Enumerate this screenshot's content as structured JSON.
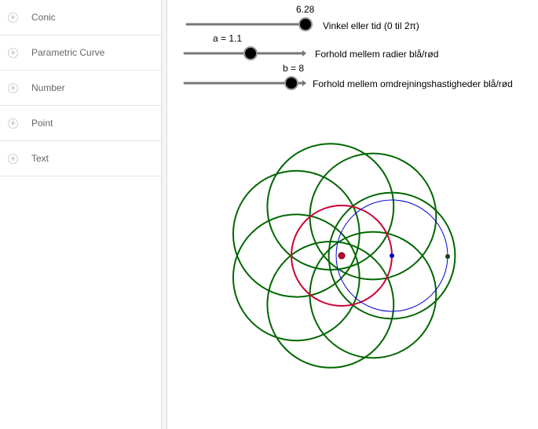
{
  "algebra": {
    "items": [
      {
        "label": "Conic"
      },
      {
        "label": "Parametric Curve"
      },
      {
        "label": "Number"
      },
      {
        "label": "Point"
      },
      {
        "label": "Text"
      }
    ],
    "expand_glyph": "+"
  },
  "sliders": {
    "angle": {
      "value_label": "6.28",
      "caption": "Vinkel eller tid (0 til 2π)",
      "value": 6.28,
      "min": 0,
      "max": 6.2832
    },
    "a": {
      "value_label": "a = 1.1",
      "caption": "Forhold mellem radier blå/rød",
      "value": 1.1
    },
    "b": {
      "value_label": "b = 8",
      "caption": "Forhold mellem omdrejningshastigheder blå/rød",
      "value": 8
    }
  },
  "colors": {
    "red_circle": "#cc0033",
    "blue_circle": "#0000cc",
    "green_circles": "#006600",
    "slider_track": "#666666",
    "slider_knob": "#000000"
  },
  "icons": {
    "expand": "plus-circle-icon"
  }
}
